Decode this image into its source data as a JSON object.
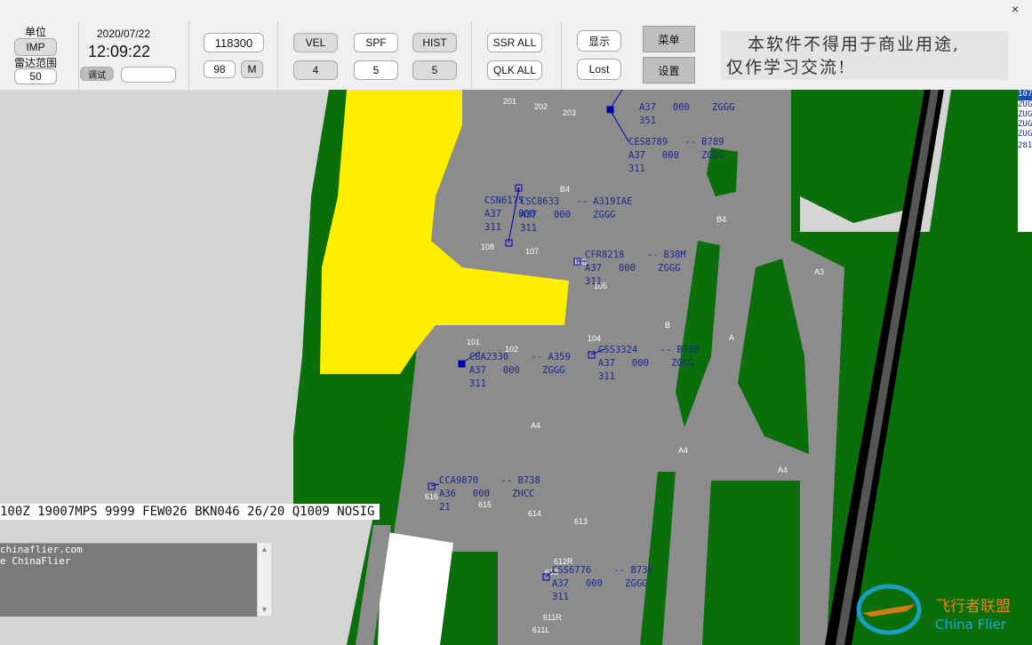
{
  "toolbar": {
    "unit_label": "单位",
    "unit_value": "IMP",
    "radar_range_label": "雷达范围",
    "radar_range_value": "50",
    "date": "2020/07/22",
    "time": "12:09:22",
    "mode_label": "调试",
    "mode_field": "",
    "freq": "118300",
    "num_98": "98",
    "m_label": "M",
    "vel_label": "VEL",
    "vel_value": "4",
    "spf_label": "SPF",
    "spf_value": "5",
    "hist_label": "HIST",
    "hist_value": "5",
    "ssr_all": "SSR ALL",
    "qlk_all": "QLK ALL",
    "show": "显示",
    "lost": "Lost",
    "menu": "菜单",
    "settings": "设置",
    "notice_line1": "本软件不得用于商业用途,",
    "notice_line2": "仅作学习交流!"
  },
  "metar": "100Z 19007MPS 9999 FEW026 BKN046 26/20 Q1009 NOSIG",
  "log": [
    "chinaflier.com",
    "e ChinaFlier"
  ],
  "right_list": [
    "107",
    "ZUG",
    "ZUG",
    "ZUG",
    "ZUG",
    "281"
  ],
  "taxiway_labels": [
    {
      "text": "201"
    },
    {
      "text": "202"
    },
    {
      "text": "203"
    },
    {
      "text": "B4"
    },
    {
      "text": "108"
    },
    {
      "text": "107"
    },
    {
      "text": "106"
    },
    {
      "text": "105"
    },
    {
      "text": "B4"
    },
    {
      "text": "A3"
    },
    {
      "text": "B"
    },
    {
      "text": "A"
    },
    {
      "text": "101"
    },
    {
      "text": "102"
    },
    {
      "text": "104"
    },
    {
      "text": "A4"
    },
    {
      "text": "A4"
    },
    {
      "text": "A4"
    },
    {
      "text": "616"
    },
    {
      "text": "615"
    },
    {
      "text": "614"
    },
    {
      "text": "613"
    },
    {
      "text": "612R"
    },
    {
      "text": "612"
    },
    {
      "text": "611R"
    },
    {
      "text": "611L"
    }
  ],
  "aircraft": [
    {
      "line1": "",
      "line2": "A37   000    ZGGG",
      "line3": "351"
    },
    {
      "line1": "CES8789   -- B789",
      "line2": "A37   000    ZGGG",
      "line3": "311"
    },
    {
      "line1": "CSN6175",
      "line2": "A37   000",
      "line3": "311"
    },
    {
      "line1": "CSC8633   -- A319IAE",
      "line2": "A37   000    ZGGG",
      "line3": "311"
    },
    {
      "line1": "CFR8218    -- B38M",
      "line2": "A37   000    ZGGG",
      "line3": "311"
    },
    {
      "line1": "CBA2330    -- A359",
      "line2": "A37   000    ZGGG",
      "line3": "311"
    },
    {
      "line1": "CSS3324    -- B73B",
      "line2": "A37   000    ZGGG",
      "line3": "311"
    },
    {
      "line1": "CCA9870    -- B738",
      "line2": "A36   000    ZHCC",
      "line3": "21"
    },
    {
      "line1": "CSS6776    -- B738",
      "line2": "A37   000    ZGGG",
      "line3": "311"
    }
  ],
  "watermark": {
    "cn": "飞行者联盟",
    "en": "China Flier"
  },
  "colors": {
    "grass": "#0a6e0a",
    "apron": "#8c8c8c",
    "terminal": "#ffee00",
    "runway": "#000000",
    "tag": "#1a2a8a"
  }
}
